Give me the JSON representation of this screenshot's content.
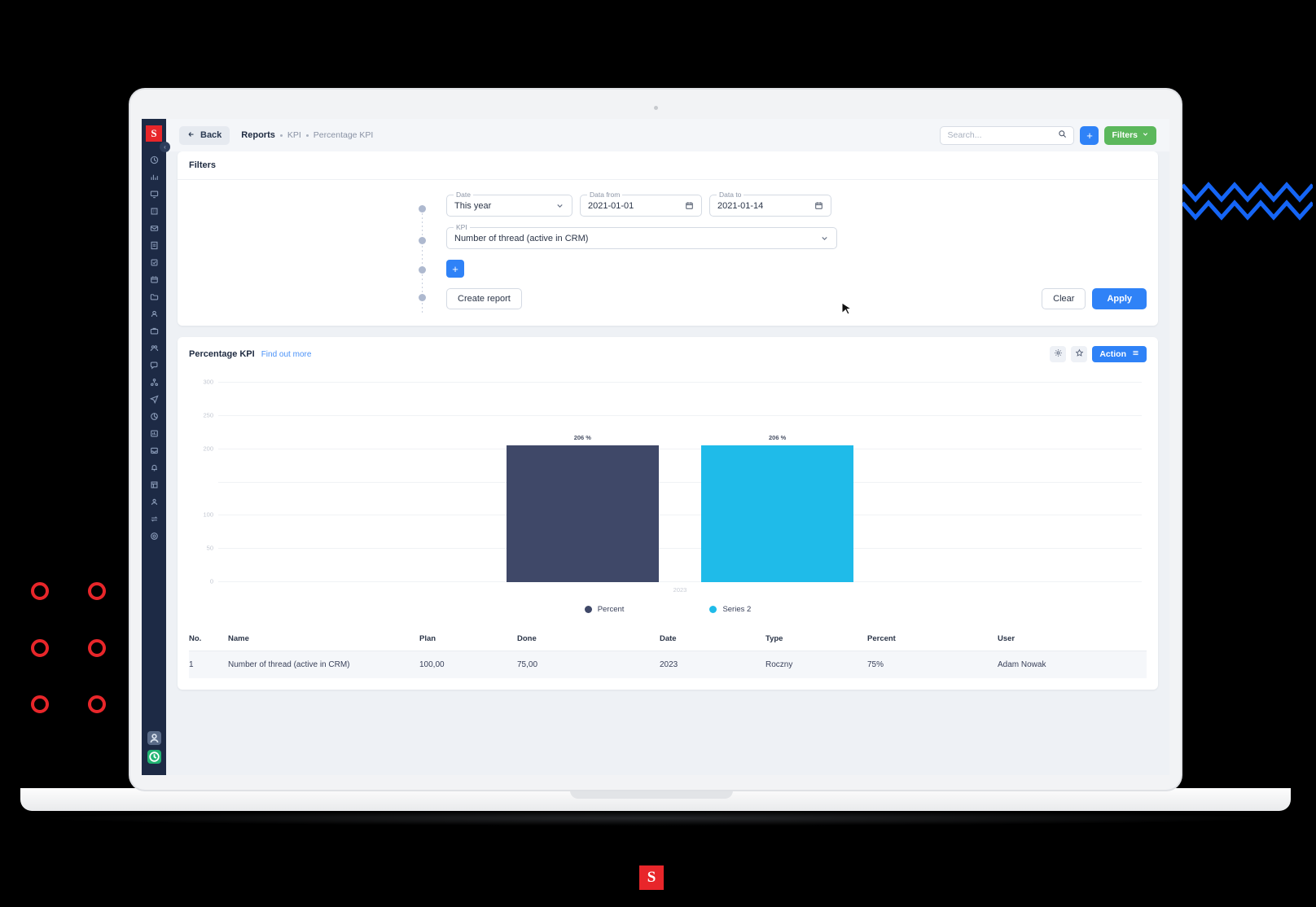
{
  "brand": {
    "mark": "S",
    "accent_red": "#e8262a"
  },
  "topbar": {
    "back_label": "Back",
    "breadcrumb": [
      "Reports",
      "KPI",
      "Percentage KPI"
    ],
    "search_placeholder": "Search...",
    "search_value": "",
    "add_label": "+",
    "filters_label": "Filters"
  },
  "filters": {
    "heading": "Filters",
    "date": {
      "label": "Date",
      "value": "This year"
    },
    "data_from": {
      "label": "Data from",
      "value": "2021-01-01"
    },
    "data_to": {
      "label": "Data to",
      "value": "2021-01-14"
    },
    "kpi": {
      "label": "KPI",
      "value": "Number of thread (active in CRM)"
    },
    "add_condition_label": "+",
    "create_report_label": "Create report",
    "clear_label": "Clear",
    "apply_label": "Apply"
  },
  "report": {
    "title": "Percentage KPI",
    "find_out_more": "Find out more",
    "action_label": "Action"
  },
  "chart_data": {
    "type": "bar",
    "title": "Percentage KPI",
    "categories": [
      "2023"
    ],
    "series": [
      {
        "name": "Percent",
        "values": [
          206
        ],
        "color": "#3f4868",
        "label": "206 %"
      },
      {
        "name": "Series 2",
        "values": [
          206
        ],
        "color": "#1fbbe9",
        "label": "206 %"
      }
    ],
    "ylabel": "",
    "xlabel": "",
    "ylim": [
      0,
      300
    ],
    "yticks": [
      0,
      50,
      100,
      150,
      200,
      250,
      300
    ],
    "ytick_labels": [
      "0",
      "50",
      "100",
      "",
      "200",
      "250",
      "300"
    ],
    "grid": true,
    "legend_position": "bottom"
  },
  "table": {
    "headers": [
      "No.",
      "Name",
      "Plan",
      "Done",
      "Date",
      "Type",
      "Percent",
      "User"
    ],
    "rows": [
      {
        "no": "1",
        "name": "Number of thread (active in CRM)",
        "plan": "100,00",
        "done": "75,00",
        "date": "2023",
        "type": "Roczny",
        "percent": "75%",
        "user": "Adam Nowak"
      }
    ]
  },
  "sidebar": {
    "items": [
      {
        "name": "dashboard"
      },
      {
        "name": "analytics"
      },
      {
        "name": "monitor"
      },
      {
        "name": "building"
      },
      {
        "name": "mail"
      },
      {
        "name": "invoice"
      },
      {
        "name": "tasks"
      },
      {
        "name": "calendar"
      },
      {
        "name": "folder"
      },
      {
        "name": "contacts"
      },
      {
        "name": "briefcase"
      },
      {
        "name": "team"
      },
      {
        "name": "chat"
      },
      {
        "name": "network"
      },
      {
        "name": "send"
      },
      {
        "name": "pie"
      },
      {
        "name": "chart-bar"
      },
      {
        "name": "inbox"
      },
      {
        "name": "bell"
      },
      {
        "name": "list"
      },
      {
        "name": "users"
      },
      {
        "name": "swap"
      },
      {
        "name": "settings"
      }
    ]
  }
}
